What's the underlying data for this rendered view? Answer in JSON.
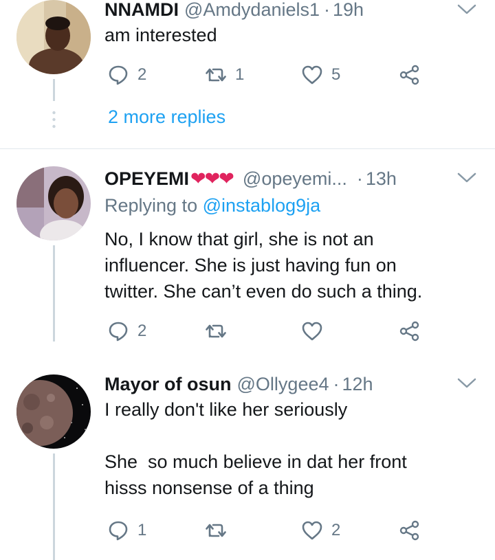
{
  "colors": {
    "accent": "#1da1f2",
    "muted": "#657786",
    "text": "#14171a",
    "heart": "#e0245e",
    "thread": "#ccd6dd"
  },
  "tweets": [
    {
      "name": "NNAMDI",
      "handle": "@Amdydaniels1",
      "separator": "·",
      "time": "19h",
      "text": "am interested",
      "replies": "2",
      "retweets": "1",
      "likes": "5",
      "more_replies": "2 more replies",
      "avatar_icon": "user-photo-avatar"
    },
    {
      "name": "OPEYEMI",
      "name_emoji": "❤❤❤",
      "handle": "@opeyemi...",
      "separator": "·",
      "time": "13h",
      "replying_prefix": "Replying to",
      "replying_to": "@instablog9ja",
      "text": "No, I know that girl, she is not an\ninfluencer. She is just having fun on\ntwitter. She can’t even do such a thing.",
      "replies": "2",
      "retweets": "",
      "likes": "",
      "avatar_icon": "user-photo-avatar"
    },
    {
      "name": "Mayor of osun",
      "handle": "@Ollygee4",
      "separator": "·",
      "time": "12h",
      "text": "I really don't like her seriously\n\nShe  so much believe in dat her front\nhisss nonsense of a thing",
      "replies": "1",
      "retweets": "",
      "likes": "2",
      "avatar_icon": "moon-avatar"
    }
  ]
}
